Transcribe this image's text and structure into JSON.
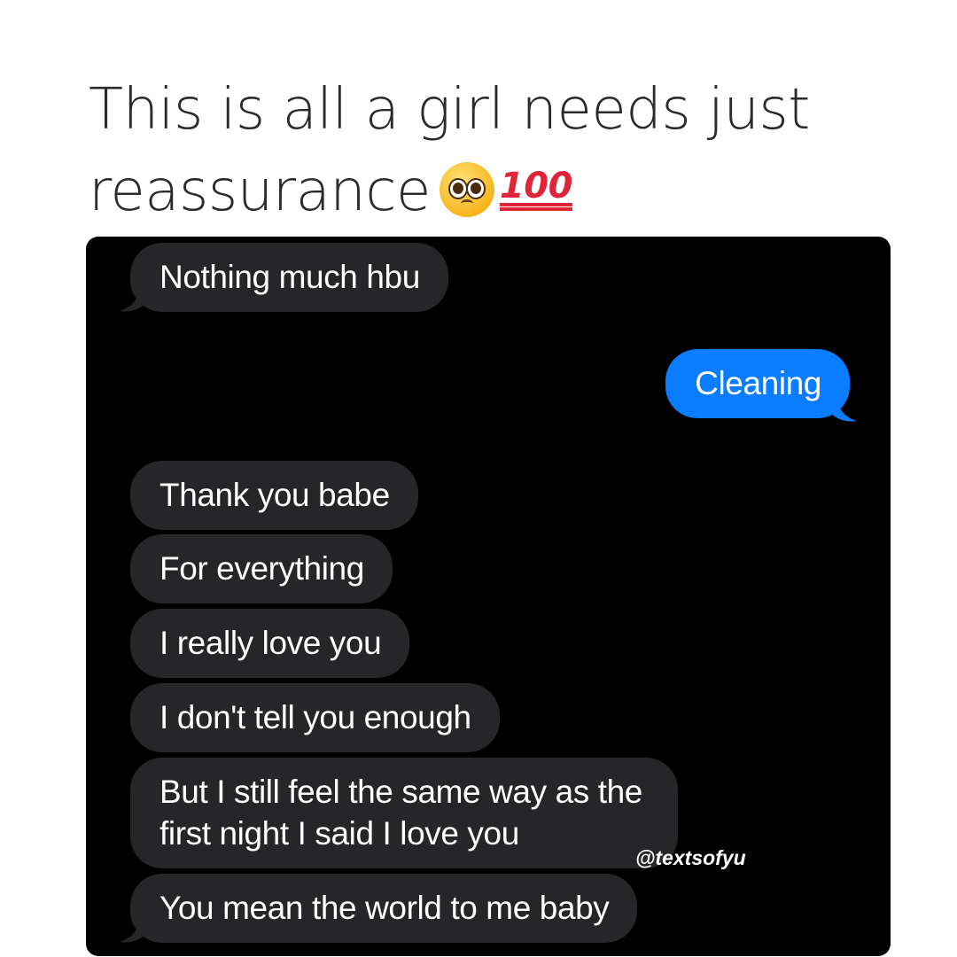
{
  "caption": {
    "line1": "This is all a girl needs just",
    "line2": "reassurance",
    "emoji_hundred": "100",
    "emoji_names": [
      "pleading-face-icon",
      "hundred-points-icon"
    ]
  },
  "messages": [
    {
      "direction": "received",
      "text": "Nothing much hbu"
    },
    {
      "direction": "sent",
      "text": "Cleaning"
    },
    {
      "direction": "received",
      "text": "Thank you babe"
    },
    {
      "direction": "received",
      "text": "For everything"
    },
    {
      "direction": "received",
      "text": "I really love you"
    },
    {
      "direction": "received",
      "text": "I don't tell you enough"
    },
    {
      "direction": "received",
      "line1": "But I still feel the same way as the",
      "line2": "first night I said I love you"
    },
    {
      "direction": "received",
      "text": "You mean the world to me baby"
    }
  ],
  "watermark": "@textsofyu",
  "colors": {
    "background": "#ffffff",
    "chat_background": "#000000",
    "received_bubble": "#262628",
    "sent_bubble": "#0a7cff",
    "caption_text": "#2b2b2b"
  }
}
